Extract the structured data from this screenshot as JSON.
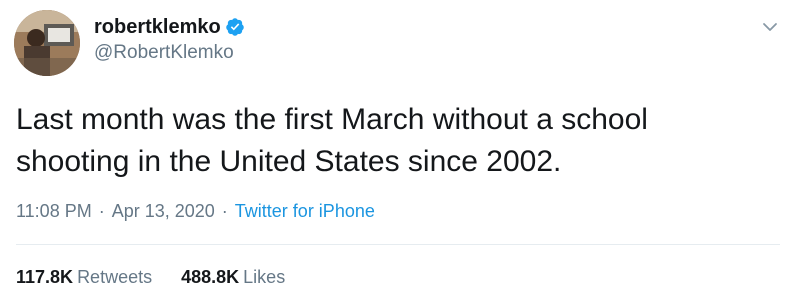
{
  "author": {
    "display_name": "robertklemko",
    "handle": "@RobertKlemko",
    "verified": true,
    "avatar_icon": "user-avatar"
  },
  "tweet": {
    "text_line1": "Last month was the first March without a school",
    "text_line2": "shooting in the United States since 2002."
  },
  "meta": {
    "time": "11:08 PM",
    "separator": "·",
    "date": "Apr 13, 2020",
    "source": "Twitter for iPhone"
  },
  "stats": {
    "retweets_count": "117.8K",
    "retweets_label": "Retweets",
    "likes_count": "488.8K",
    "likes_label": "Likes"
  },
  "colors": {
    "text": "#14171a",
    "secondary": "#657786",
    "link": "#1b95e0",
    "verified": "#1da1f2",
    "divider": "#e6ecf0"
  },
  "icons": {
    "verified": "verified-badge-icon",
    "menu": "chevron-down-icon"
  }
}
